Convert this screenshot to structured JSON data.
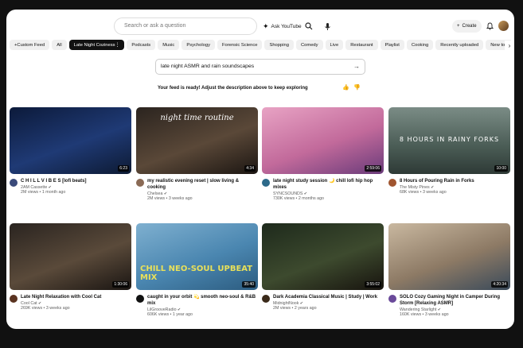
{
  "topbar": {
    "search_placeholder": "Search or ask a question",
    "ask_label": "Ask YouTube",
    "create_label": "Create"
  },
  "chips": [
    {
      "label": "Custom Feed",
      "style": "custom"
    },
    {
      "label": "All",
      "style": "normal"
    },
    {
      "label": "Late Night Coziness",
      "style": "dark"
    },
    {
      "label": "Podcasts",
      "style": "normal"
    },
    {
      "label": "Music",
      "style": "normal"
    },
    {
      "label": "Psychology",
      "style": "normal"
    },
    {
      "label": "Forensic Science",
      "style": "normal"
    },
    {
      "label": "Shopping",
      "style": "normal"
    },
    {
      "label": "Comedy",
      "style": "normal"
    },
    {
      "label": "Live",
      "style": "normal"
    },
    {
      "label": "Restaurant",
      "style": "normal"
    },
    {
      "label": "Playlist",
      "style": "normal"
    },
    {
      "label": "Cooking",
      "style": "normal"
    },
    {
      "label": "Recently uploaded",
      "style": "normal"
    },
    {
      "label": "New to you",
      "style": "normal"
    }
  ],
  "prompt": {
    "value": "late night ASMR and rain soundscapes"
  },
  "feed_message": "Your feed is ready! Adjust the description above to keep exploring",
  "videos": [
    {
      "title": "C H I L L  V I B E S [lofi beats]",
      "channel": "2AM Cassette",
      "stats": "2M views • 1 month ago",
      "duration": "6:23",
      "thumb_text": "",
      "avatar_color": "#3a4a7a",
      "thumb_bg": "linear-gradient(160deg,#0c1a3a,#1f3a75 55%,#0d1a33)"
    },
    {
      "title": "my realistic evening reset | slow living & cooking",
      "channel": "Chelsea",
      "stats": "2M views • 3 weeks ago",
      "duration": "4:34",
      "thumb_text": "night time routine",
      "avatar_color": "#8a6a55",
      "thumb_bg": "linear-gradient(160deg,#2b241f,#5a4838 55%,#1c1612)"
    },
    {
      "title": "late night study session 🌙 chill lofi hip hop mixes",
      "channel": "SYNCSOUNDS",
      "stats": "730K views • 2 months ago",
      "duration": "2:59:06",
      "thumb_text": "",
      "avatar_color": "#2d6a8a",
      "thumb_bg": "linear-gradient(160deg,#e8a3c4,#c26a9b 55%,#6a3b7a)"
    },
    {
      "title": "8 Hours of Pouring Rain in Forks",
      "channel": "The Misty Pines",
      "stats": "68K views • 3 weeks ago",
      "duration": "10:00",
      "thumb_text": "8 HOURS IN RAINY FORKS",
      "avatar_color": "#a0552f",
      "thumb_bg": "linear-gradient(180deg,#7b8c86,#4d5f58 55%,#2e3a36)"
    },
    {
      "title": "Late Night Relaxation with Cool Cat",
      "channel": "Cool Cat",
      "stats": "269K views • 3 weeks ago",
      "duration": "1:30:06",
      "thumb_text": "",
      "avatar_color": "#5a3320",
      "thumb_bg": "linear-gradient(160deg,#2a2420,#5a4a3a 55%,#1a1512)"
    },
    {
      "title": "caught in your orbit 💫 smooth neo-soul & R&B mix",
      "channel": "LilGrooveRadio",
      "stats": "606K views • 1 year ago",
      "duration": "35:40",
      "thumb_text": "CHILL NEO-SOUL UPBEAT MIX",
      "avatar_color": "#111111",
      "thumb_bg": "linear-gradient(160deg,#7fb0d0,#4a86b0 55%,#2c5c80)"
    },
    {
      "title": "Dark Academia Classical Music | Study | Work",
      "channel": "MidnightNook",
      "stats": "2M views • 2 years ago",
      "duration": "3:55:02",
      "thumb_text": "",
      "avatar_color": "#3a2a1a",
      "thumb_bg": "linear-gradient(160deg,#1e2a1c,#3d4a2e 55%,#17130e)"
    },
    {
      "title": "SOLO Cozy Gaming Night in Camper During Storm [Relaxing ASMR]",
      "channel": "Wandering Starlight",
      "stats": "160K views • 3 weeks ago",
      "duration": "4:20:34",
      "thumb_text": "",
      "avatar_color": "#6a4a9a",
      "thumb_bg": "linear-gradient(160deg,#c9b8a0,#8d7a65 55%,#3a4a5a)"
    }
  ]
}
